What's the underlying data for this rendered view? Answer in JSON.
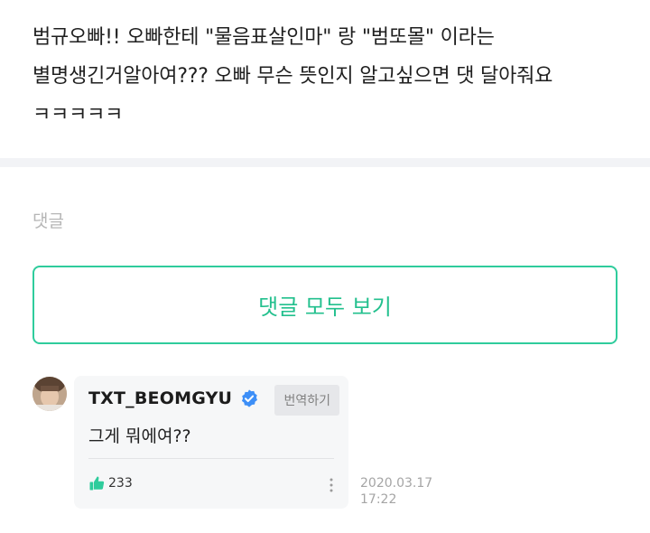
{
  "post": {
    "lines": [
      "범규오빠!! 오빠한테 \"물음표살인마\" 랑 \"범또몰\" 이라는",
      "별명생긴거알아여??? 오빠 무슨 뜻인지 알고싶으면 댓 달아줘요",
      "ㅋㅋㅋㅋㅋ"
    ]
  },
  "comments": {
    "section_label": "댓글",
    "view_all_label": "댓글 모두 보기",
    "items": [
      {
        "author": "TXT_BEOMGYU",
        "verified_icon": "verified-badge-icon",
        "translate_label": "번역하기",
        "text": "그게 뭐에여??",
        "likes": "233",
        "date": "2020.03.17",
        "time": "17:22"
      }
    ]
  },
  "colors": {
    "accent": "#23c08e",
    "verified": "#3d8ff7",
    "divider": "#f2f3f6"
  }
}
